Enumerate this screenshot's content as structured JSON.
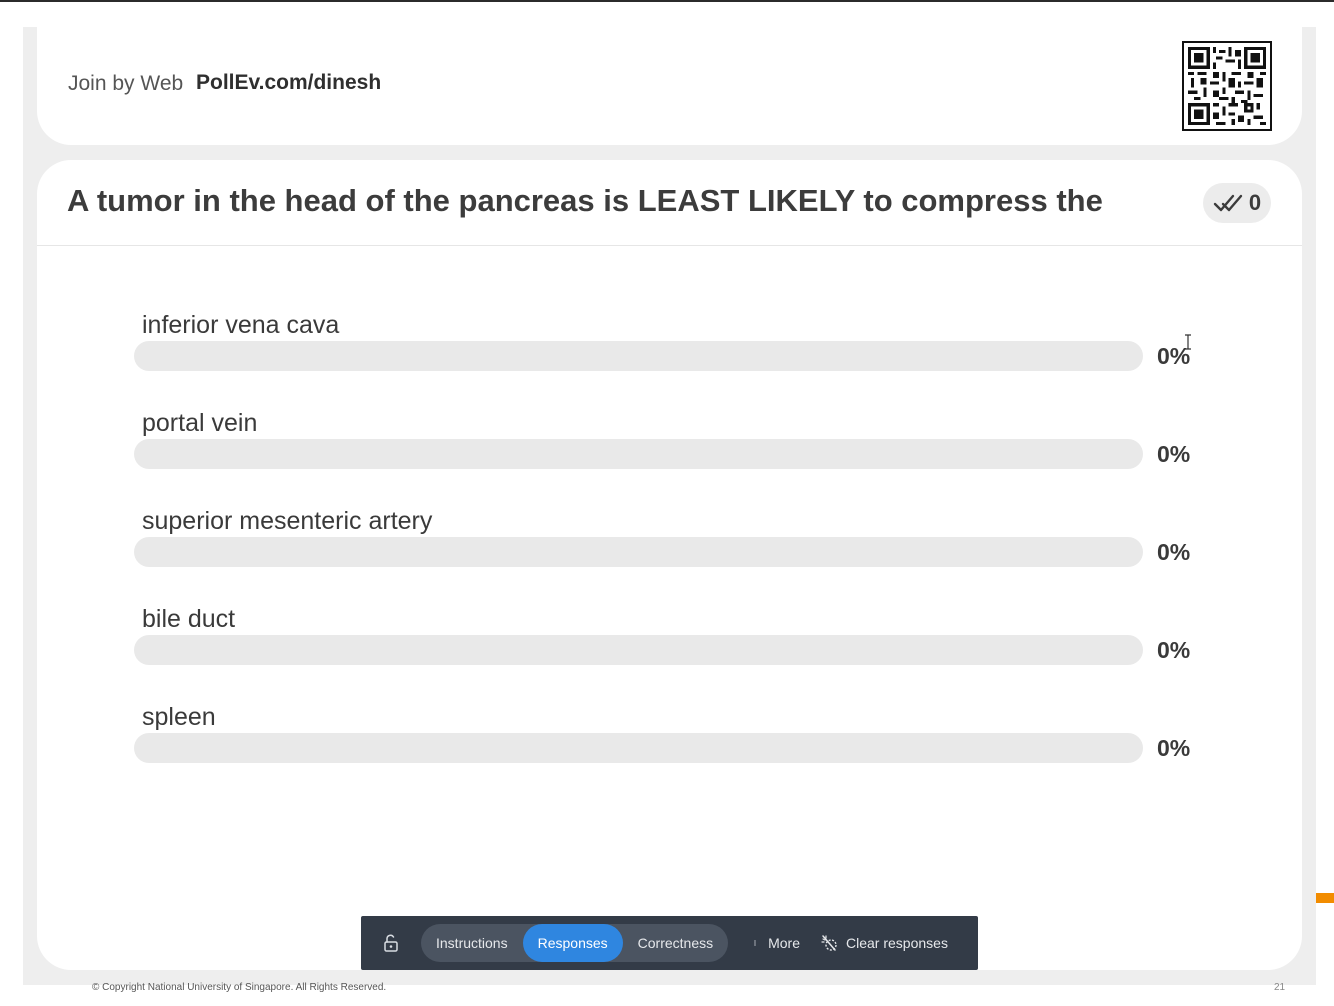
{
  "join": {
    "label": "Join by Web",
    "url": "PollEv.com/dinesh"
  },
  "poll": {
    "question": "A tumor in the head of the pancreas is LEAST LIKELY to compress the",
    "response_count": "0",
    "options": [
      {
        "label": "inferior vena cava",
        "percent": "0%",
        "value": 0
      },
      {
        "label": "portal vein",
        "percent": "0%",
        "value": 0
      },
      {
        "label": "superior mesenteric artery",
        "percent": "0%",
        "value": 0
      },
      {
        "label": "bile duct",
        "percent": "0%",
        "value": 0
      },
      {
        "label": "spleen",
        "percent": "0%",
        "value": 0
      }
    ]
  },
  "toolbar": {
    "instructions": "Instructions",
    "responses": "Responses",
    "correctness": "Correctness",
    "more": "More",
    "clear": "Clear responses",
    "active_tab": "Responses"
  },
  "footer": {
    "copyright": "© Copyright National University of Singapore. All Rights Reserved.",
    "page_number": "21"
  },
  "colors": {
    "accent": "#2f86e0",
    "toolbar_bg": "#333b47",
    "bar_bg": "#e9e9e9",
    "orange_marker": "#f28c00"
  }
}
